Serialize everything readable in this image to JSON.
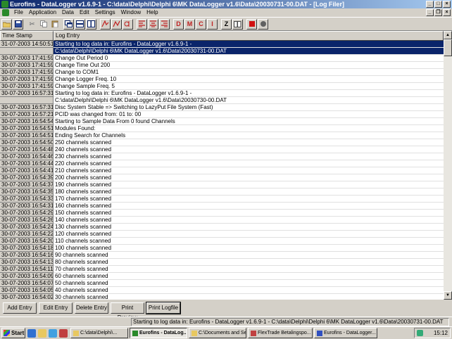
{
  "window": {
    "title": "Eurofins - DataLogger v1.6.9-1 - C:\\data\\Delphi\\Delphi 6\\MK DataLogger v1.6\\Data\\20030731-00.DAT - [Log Filer]"
  },
  "menu": {
    "items": [
      "File",
      "Application",
      "Data",
      "Edit",
      "Settings",
      "Window",
      "Help"
    ]
  },
  "toolbar": {
    "letters": {
      "d": "D",
      "m": "M",
      "c": "C",
      "i": "I",
      "z": "Z"
    }
  },
  "grid": {
    "headers": {
      "timestamp": "Time Stamp",
      "log": "Log Entry"
    },
    "rows": [
      {
        "ts": "31-07-2003 14:50:51",
        "log": "Starting to log data in: Eurofins - DataLogger v1.6.9-1 -",
        "selected": true
      },
      {
        "ts": "",
        "log": "C:\\data\\Delphi\\Delphi 6\\MK DataLogger v1.6\\Data\\20030731-00.DAT",
        "selected": true
      },
      {
        "ts": "30-07-2003 17:41:59",
        "log": "Change Out Period 0"
      },
      {
        "ts": "30-07-2003 17:41:59",
        "log": "Change Time Out 200"
      },
      {
        "ts": "30-07-2003 17:41:59",
        "log": "Change to COM1"
      },
      {
        "ts": "30-07-2003 17:41:59",
        "log": "Change Logger Freq. 10"
      },
      {
        "ts": "30-07-2003 17:41:59",
        "log": "Change Sample Freq. 5"
      },
      {
        "ts": "30-07-2003 16:57:31",
        "log": "Starting to log data in: Eurofins - DataLogger v1.6.9-1 -"
      },
      {
        "ts": "",
        "log": "C:\\data\\Delphi\\Delphi 6\\MK DataLogger v1.6\\Data\\20030730-00.DAT"
      },
      {
        "ts": "30-07-2003 16:57:31",
        "log": "Disc System Stable => Switching to LazyPut File System (Fast)"
      },
      {
        "ts": "30-07-2003 16:57:21",
        "log": "PCID was changed from: 01 to: 00"
      },
      {
        "ts": "30-07-2003 16:54:54",
        "log": "Starting to Sample Data From 0 found Channels"
      },
      {
        "ts": "30-07-2003 16:54:51",
        "log": "Modules Found:"
      },
      {
        "ts": "30-07-2003 16:54:51",
        "log": "Ending Search for Channels"
      },
      {
        "ts": "30-07-2003 16:54:50",
        "log": "250 channels scanned"
      },
      {
        "ts": "30-07-2003 16:54:48",
        "log": "240 channels scanned"
      },
      {
        "ts": "30-07-2003 16:54:46",
        "log": "230 channels scanned"
      },
      {
        "ts": "30-07-2003 16:54:44",
        "log": "220 channels scanned"
      },
      {
        "ts": "30-07-2003 16:54:41",
        "log": "210 channels scanned"
      },
      {
        "ts": "30-07-2003 16:54:39",
        "log": "200 channels scanned"
      },
      {
        "ts": "30-07-2003 16:54:37",
        "log": "190 channels scanned"
      },
      {
        "ts": "30-07-2003 16:54:35",
        "log": "180 channels scanned"
      },
      {
        "ts": "30-07-2003 16:54:33",
        "log": "170 channels scanned"
      },
      {
        "ts": "30-07-2003 16:54:31",
        "log": "160 channels scanned"
      },
      {
        "ts": "30-07-2003 16:54:29",
        "log": "150 channels scanned"
      },
      {
        "ts": "30-07-2003 16:54:26",
        "log": "140 channels scanned"
      },
      {
        "ts": "30-07-2003 16:54:24",
        "log": "130 channels scanned"
      },
      {
        "ts": "30-07-2003 16:54:22",
        "log": "120 channels scanned"
      },
      {
        "ts": "30-07-2003 16:54:20",
        "log": "110 channels scanned"
      },
      {
        "ts": "30-07-2003 16:54:18",
        "log": "100 channels scanned"
      },
      {
        "ts": "30-07-2003 16:54:16",
        "log": "90 channels scanned"
      },
      {
        "ts": "30-07-2003 16:54:13",
        "log": "80 channels scanned"
      },
      {
        "ts": "30-07-2003 16:54:11",
        "log": "70 channels scanned"
      },
      {
        "ts": "30-07-2003 16:54:09",
        "log": "60 channels scanned"
      },
      {
        "ts": "30-07-2003 16:54:07",
        "log": "50 channels scanned"
      },
      {
        "ts": "30-07-2003 16:54:05",
        "log": "40 channels scanned"
      },
      {
        "ts": "30-07-2003 16:54:02",
        "log": "30 channels scanned"
      }
    ]
  },
  "buttons": {
    "add": "Add Entry",
    "edit": "Edit Entry",
    "delete": "Delete Entry",
    "preview": "Print Preview",
    "print": "Print Logfile"
  },
  "status": {
    "text": "Starting to log data in: Eurofins - DataLogger v1.6.9-1 - C:\\data\\Delphi\\Delphi 6\\MK DataLogger v1.6\\Data\\20030731-00.DAT"
  },
  "taskbar": {
    "start": "Start",
    "tasks": [
      {
        "label": "C:\\data\\Delphi\\...",
        "icon_color": "#e8c860",
        "active": false
      },
      {
        "label": "Eurofins - DataLog...",
        "icon_color": "#2a8a2a",
        "active": true
      },
      {
        "label": "C:\\Documents and Se...",
        "icon_color": "#e8c860",
        "active": false
      },
      {
        "label": "FlexTrade Betalingspo...",
        "icon_color": "#c04040",
        "active": false
      },
      {
        "label": "Eurofins - DataLogger...",
        "icon_color": "#3050c0",
        "active": false
      }
    ],
    "clock": "15:12"
  },
  "colors": {
    "selection": "#0a246a",
    "title_start": "#0a246a",
    "title_end": "#a6caf0",
    "chrome": "#d4d0c8"
  }
}
